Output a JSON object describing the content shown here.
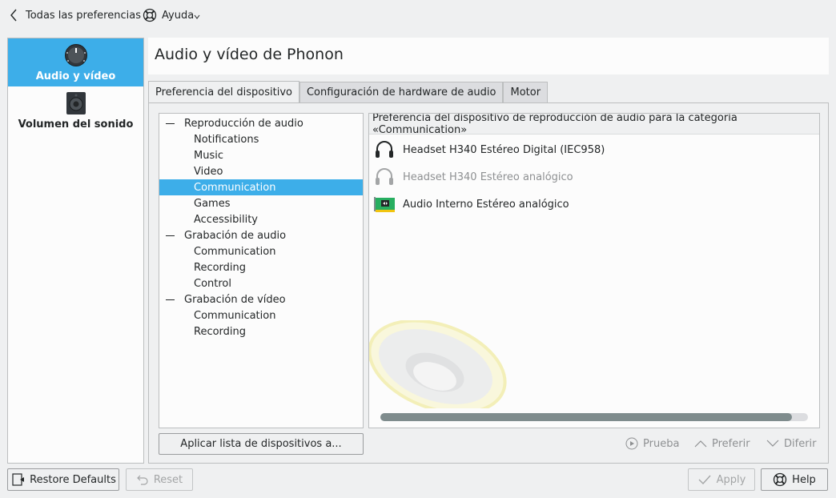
{
  "topbar": {
    "back_label": "Todas las preferencias",
    "help_label": "Ayuda"
  },
  "sidebar": {
    "items": [
      {
        "label": "Audio y vídeo",
        "icon": "knob-icon",
        "active": true
      },
      {
        "label": "Volumen del sonido",
        "icon": "speaker-box-icon",
        "active": false
      }
    ]
  },
  "main": {
    "title": "Audio y vídeo de Phonon",
    "tabs": [
      {
        "label": "Preferencia del dispositivo",
        "active": true
      },
      {
        "label": "Configuración de hardware de audio",
        "active": false
      },
      {
        "label": "Motor",
        "active": false
      }
    ],
    "tree": [
      {
        "label": "Reproducción de audio",
        "level": 0
      },
      {
        "label": "Notifications",
        "level": 1
      },
      {
        "label": "Music",
        "level": 1
      },
      {
        "label": "Video",
        "level": 1
      },
      {
        "label": "Communication",
        "level": 1,
        "selected": true
      },
      {
        "label": "Games",
        "level": 1
      },
      {
        "label": "Accessibility",
        "level": 1
      },
      {
        "label": "Grabación de audio",
        "level": 0
      },
      {
        "label": "Communication",
        "level": 1
      },
      {
        "label": "Recording",
        "level": 1
      },
      {
        "label": "Control",
        "level": 1
      },
      {
        "label": "Grabación de vídeo",
        "level": 0
      },
      {
        "label": "Communication",
        "level": 1
      },
      {
        "label": "Recording",
        "level": 1
      }
    ],
    "apply_list_label": "Aplicar lista de dispositivos a...",
    "device_header": "Preferencia del dispositivo de reproducción de audio para la categoría «Communication»",
    "devices": [
      {
        "label": "Headset H340 Estéreo Digital (IEC958)",
        "icon": "headset-icon",
        "available": true
      },
      {
        "label": "Headset H340 Estéreo analógico",
        "icon": "headset-icon",
        "available": false
      },
      {
        "label": "Audio Interno Estéreo analógico",
        "icon": "sound-card-icon",
        "available": true
      }
    ],
    "actions": {
      "test_label": "Prueba",
      "prefer_label": "Preferir",
      "defer_label": "Diferir"
    }
  },
  "footer": {
    "restore_label": "Restore Defaults",
    "reset_label": "Reset",
    "apply_label": "Apply",
    "help_label": "Help"
  },
  "colors": {
    "accent": "#3daee9",
    "window_bg": "#eff0f1",
    "view_bg": "#fcfcfc"
  }
}
